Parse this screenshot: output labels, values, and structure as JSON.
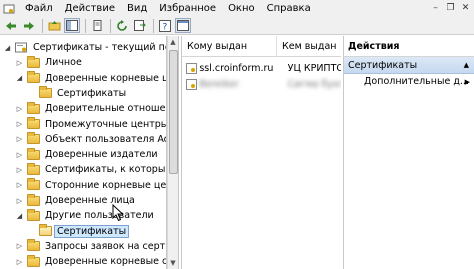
{
  "menu": {
    "items": [
      "Файл",
      "Действие",
      "Вид",
      "Избранное",
      "Окно",
      "Справка"
    ]
  },
  "window_controls": {
    "minimize": "–",
    "restore": "❐",
    "close": "✕"
  },
  "toolbar": {
    "buttons": [
      "back-arrow-icon",
      "forward-arrow-icon",
      "up-folder-icon",
      "show-hide-tree-icon",
      "copy-icon",
      "refresh-icon",
      "export-list-icon",
      "help-icon",
      "properties-icon"
    ]
  },
  "tree": {
    "items": [
      {
        "label": "Сертификаты - текущий пользов",
        "level": 0,
        "expander": "◢",
        "icon": "certificate-store-icon"
      },
      {
        "label": "Личное",
        "level": 1,
        "expander": "▷",
        "icon": "folder-icon"
      },
      {
        "label": "Доверенные корневые центр",
        "level": 1,
        "expander": "◢",
        "icon": "folder-icon"
      },
      {
        "label": "Сертификаты",
        "level": 2,
        "expander": "",
        "icon": "folder-icon"
      },
      {
        "label": "Доверительные отношения в",
        "level": 1,
        "expander": "▷",
        "icon": "folder-icon"
      },
      {
        "label": "Промежуточные центры серт",
        "level": 1,
        "expander": "▷",
        "icon": "folder-icon"
      },
      {
        "label": "Объект пользователя Active",
        "level": 1,
        "expander": "▷",
        "icon": "folder-icon"
      },
      {
        "label": "Доверенные издатели",
        "level": 1,
        "expander": "▷",
        "icon": "folder-icon"
      },
      {
        "label": "Сертификаты, к которым нет",
        "level": 1,
        "expander": "▷",
        "icon": "folder-icon"
      },
      {
        "label": "Сторонние корневые центры",
        "level": 1,
        "expander": "▷",
        "icon": "folder-icon"
      },
      {
        "label": "Доверенные лица",
        "level": 1,
        "expander": "▷",
        "icon": "folder-icon"
      },
      {
        "label": "Другие пользователи",
        "level": 1,
        "expander": "◢",
        "icon": "folder-icon"
      },
      {
        "label": "Сертификаты",
        "level": 2,
        "expander": "",
        "icon": "folder-open-icon",
        "selected": true
      },
      {
        "label": "Запросы заявок на сертифик",
        "level": 1,
        "expander": "▷",
        "icon": "folder-icon"
      },
      {
        "label": "Доверенные корневые серти",
        "level": 1,
        "expander": "▷",
        "icon": "folder-icon"
      }
    ]
  },
  "list": {
    "columns": [
      "Кому выдан",
      "Кем выдан"
    ],
    "rows": [
      {
        "issued_to": "ssl.croinform.ru",
        "issued_by": "УЦ КРИПТО-ПРО",
        "blurred": false
      },
      {
        "issued_to": "Bereiker",
        "issued_by": "Сигма бухгал",
        "blurred": true
      }
    ]
  },
  "actions": {
    "title": "Действия",
    "section": "Сертификаты",
    "section_arrow": "▲",
    "items": [
      {
        "label": "Дополнительные д...",
        "arrow": "▶"
      }
    ]
  }
}
